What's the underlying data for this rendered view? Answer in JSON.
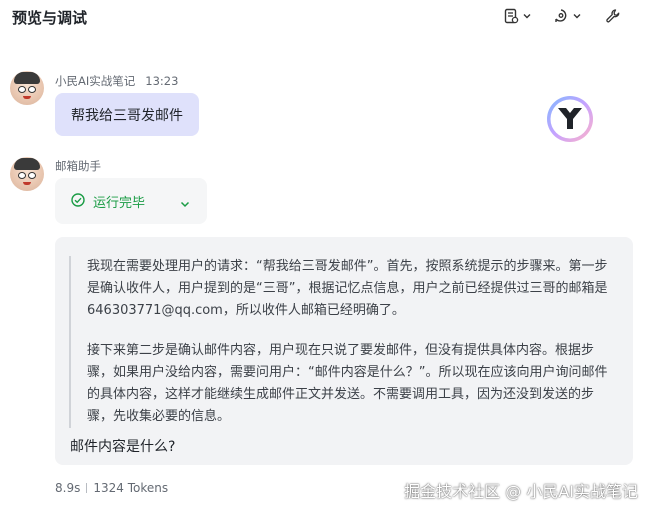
{
  "header": {
    "title": "预览与调试",
    "buttons": [
      {
        "name": "notes-icon"
      },
      {
        "name": "debug-icon"
      },
      {
        "name": "wrench-icon"
      }
    ]
  },
  "messages": {
    "user": {
      "sender": "小民AI实战笔记",
      "time": "13:23",
      "text": "帮我给三哥发邮件"
    },
    "assistant": {
      "sender": "邮箱助手",
      "status": "运行完毕",
      "thinking": [
        "我现在需要处理用户的请求：“帮我给三哥发邮件”。首先，按照系统提示的步骤来。第一步是确认收件人，用户提到的是“三哥”，根据记忆点信息，用户之前已经提供过三哥的邮箱是646303771@qq.com，所以收件人邮箱已经明确了。",
        "接下来第二步是确认邮件内容，用户现在只说了要发邮件，但没有提供具体内容。根据步骤，如果用户没给内容，需要问用户：“邮件内容是什么？”。所以现在应该向用户询问邮件的具体内容，这样才能继续生成邮件正文并发送。不需要调用工具，因为还没到发送的步骤，先收集必要的信息。"
      ],
      "answer": "邮件内容是什么?"
    }
  },
  "stats": {
    "duration": "8.9s",
    "tokens": "1324 Tokens"
  },
  "watermark": "掘金技术社区 @ 小民AI实战笔记",
  "colors": {
    "user_bubble": "#dfe1fb",
    "status_green": "#1a9c45",
    "card_bg": "#f2f3f5"
  }
}
